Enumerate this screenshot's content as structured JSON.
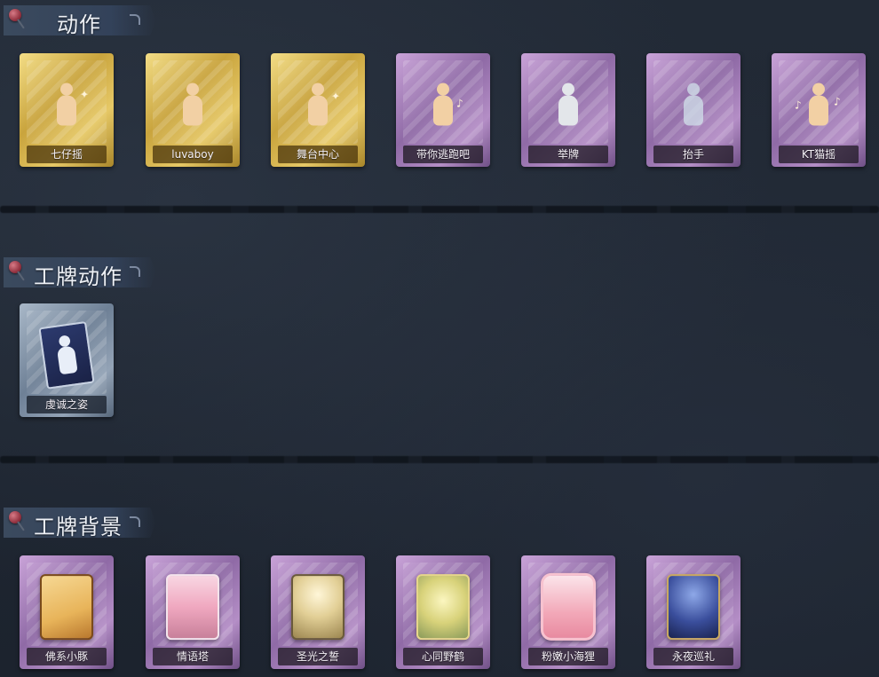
{
  "sections": [
    {
      "title": "动作",
      "cards": [
        {
          "label": "七仔摇",
          "rarity": "gold",
          "icon": "pose-figure-icon"
        },
        {
          "label": "luvaboy",
          "rarity": "gold",
          "icon": "pose-figure-icon"
        },
        {
          "label": "舞台中心",
          "rarity": "gold",
          "icon": "pose-figure-icon"
        },
        {
          "label": "带你逃跑吧",
          "rarity": "purple",
          "icon": "dance-figure-icon"
        },
        {
          "label": "举牌",
          "rarity": "purple",
          "icon": "sign-hold-icon"
        },
        {
          "label": "抬手",
          "rarity": "purple",
          "icon": "raise-hand-icon"
        },
        {
          "label": "KT猫摇",
          "rarity": "purple",
          "icon": "music-figure-icon"
        }
      ]
    },
    {
      "title": "工牌动作",
      "cards": [
        {
          "label": "虔诚之姿",
          "rarity": "blue",
          "icon": "card-silhouette-icon"
        }
      ]
    },
    {
      "title": "工牌背景",
      "cards": [
        {
          "label": "佛系小豚",
          "rarity": "purple",
          "icon": "badge-background-icon",
          "art_color": "#e8b45a"
        },
        {
          "label": "情语塔",
          "rarity": "purple",
          "icon": "badge-background-icon",
          "art_color": "#f0a8c0"
        },
        {
          "label": "圣光之誓",
          "rarity": "purple",
          "icon": "badge-background-icon",
          "art_color": "#e2cf96"
        },
        {
          "label": "心同野鹤",
          "rarity": "purple",
          "icon": "badge-background-icon",
          "art_color": "#d8d27a"
        },
        {
          "label": "粉嫩小海狸",
          "rarity": "purple",
          "icon": "badge-background-icon",
          "art_color": "#f2a8b8"
        },
        {
          "label": "永夜巡礼",
          "rarity": "purple",
          "icon": "badge-background-icon",
          "art_color": "#3a4e9c"
        }
      ]
    }
  ],
  "colors": {
    "gold": "#c9a43d",
    "purple": "#8f6aa6",
    "blue": "#6e8096",
    "background": "#1f2632"
  }
}
